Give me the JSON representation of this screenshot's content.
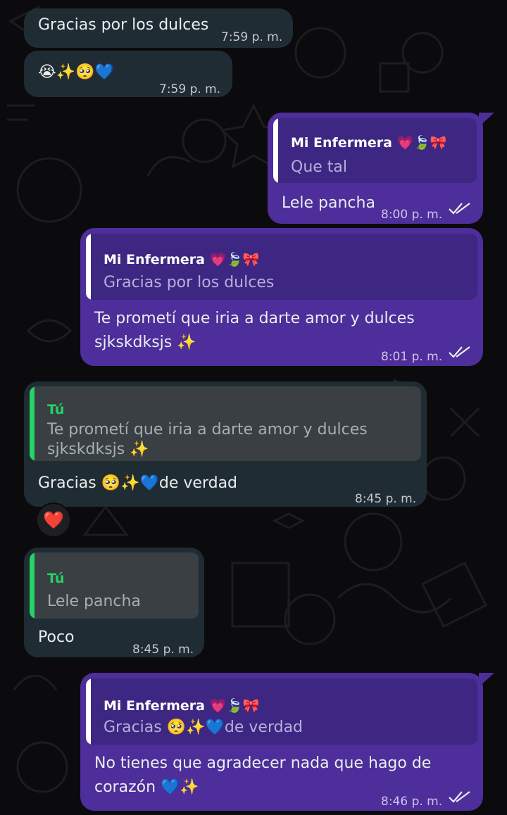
{
  "messages": [
    {
      "id": "m1",
      "direction": "in",
      "text": "Gracias por los dulces",
      "time": "7:59 p. m."
    },
    {
      "id": "m2",
      "direction": "in",
      "text": "😭✨🥺💙",
      "time": "7:59 p. m."
    },
    {
      "id": "m3",
      "direction": "out",
      "quote_author": "Mi Enfermera 💗🍃🎀",
      "quote_text": "Que tal",
      "text": "Lele pancha",
      "time": "8:00 p. m.",
      "status": "read"
    },
    {
      "id": "m4",
      "direction": "out",
      "quote_author": "Mi Enfermera 💗🍃🎀",
      "quote_text": "Gracias por los dulces",
      "text_line1": "Te prometí que iria a darte amor y dulces",
      "text_line2": "sjkskdksjs ✨",
      "time": "8:01 p. m.",
      "status": "read"
    },
    {
      "id": "m5",
      "direction": "in",
      "quote_author": "Tú",
      "quote_line1": "Te prometí que iria a darte amor y dulces",
      "quote_line2": "sjkskdksjs ✨",
      "text": "Gracias 🥺✨💙de verdad",
      "time": "8:45 p. m.",
      "reaction": "❤️"
    },
    {
      "id": "m6",
      "direction": "in",
      "quote_author": "Tú",
      "quote_text": "Lele pancha",
      "text": "Poco",
      "time": "8:45 p. m."
    },
    {
      "id": "m7",
      "direction": "out",
      "quote_author": "Mi Enfermera 💗🍃🎀",
      "quote_text": "Gracias 🥺✨💙de verdad",
      "text_line1": "No tienes que agradecer nada que hago de",
      "text_line2": "corazón 💙✨",
      "time": "8:46 p. m.",
      "status": "read"
    }
  ],
  "colors": {
    "incoming_bubble": "#202c33",
    "outgoing_bubble": "#4d2e9a",
    "quote_bar_outgoing": "#ffffff",
    "quote_bar_incoming": "#25d366",
    "read_ticks": "#e9edef"
  },
  "icons": {
    "read_receipt": "double-check-icon",
    "reaction": "heart-reaction"
  }
}
